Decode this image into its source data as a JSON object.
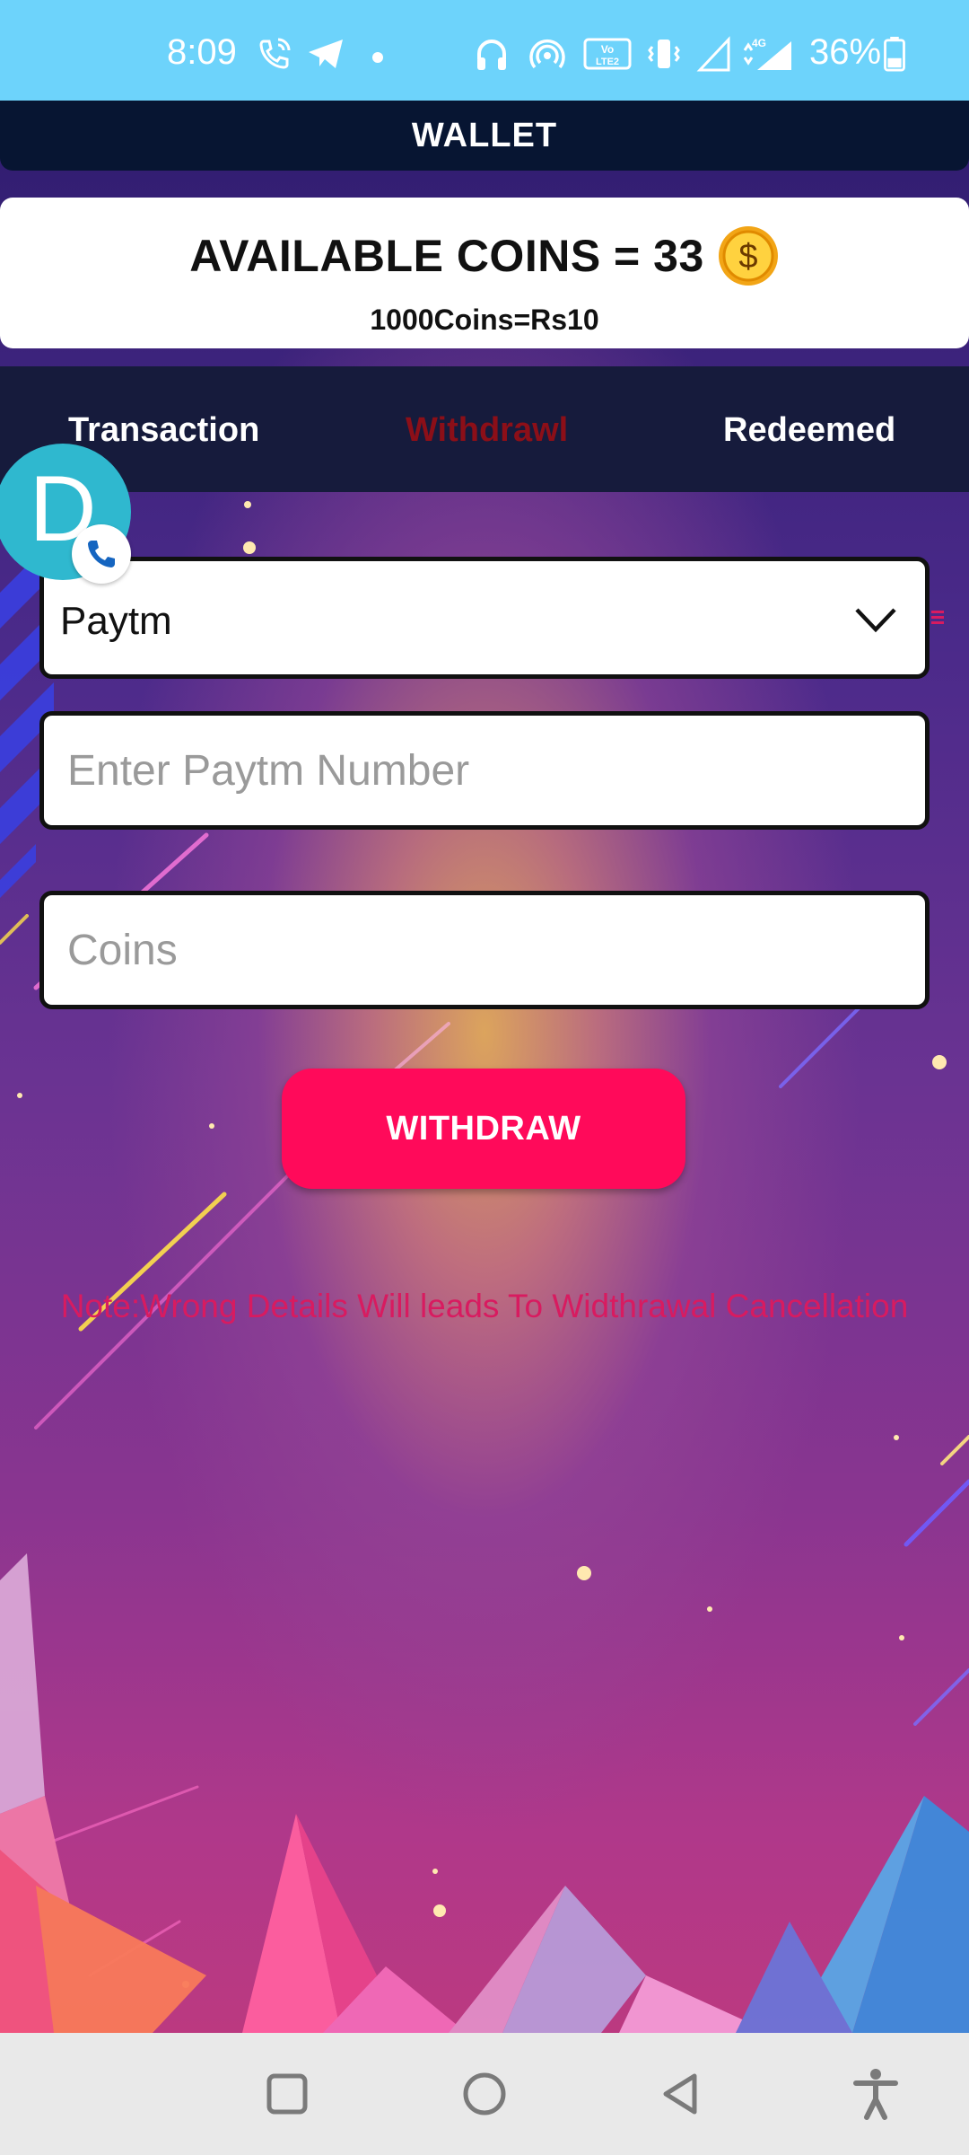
{
  "status_bar": {
    "time": "8:09",
    "battery_percent": "36%",
    "icons": [
      "wifi-calling-icon",
      "telegram-icon",
      "dot-icon",
      "headphones-icon",
      "hotspot-icon",
      "volte-icon",
      "vibrate-icon",
      "signal-icon",
      "4g-signal-icon",
      "battery-icon"
    ]
  },
  "app_bar": {
    "title": "WALLET"
  },
  "coins": {
    "title": "AVAILABLE COINS = 33",
    "rate": "1000Coins=Rs10",
    "icon": "dollar-coin-icon"
  },
  "tabs": [
    {
      "label": "Transaction",
      "active": false
    },
    {
      "label": "Withdrawl",
      "active": true
    },
    {
      "label": "Redeemed",
      "active": false
    }
  ],
  "floating_bubble": {
    "letter": "D",
    "badge_icon": "phone-icon"
  },
  "form": {
    "method_selected": "Paytm",
    "phone_placeholder": "Enter Paytm Number",
    "coins_placeholder": "Coins",
    "submit_label": "WITHDRAW"
  },
  "note": "Note:Wrong Details Will leads To Widthrawal Cancellation",
  "nav_bar": {
    "buttons": [
      "recents-icon",
      "home-icon",
      "back-icon",
      "accessibility-icon"
    ]
  },
  "colors": {
    "status_bar": "#6dd3fb",
    "app_bar": "#071532",
    "tabs_bg": "#161b3c",
    "active_tab": "#8c0f18",
    "button": "#ff0a5a",
    "note": "#d81b60"
  }
}
